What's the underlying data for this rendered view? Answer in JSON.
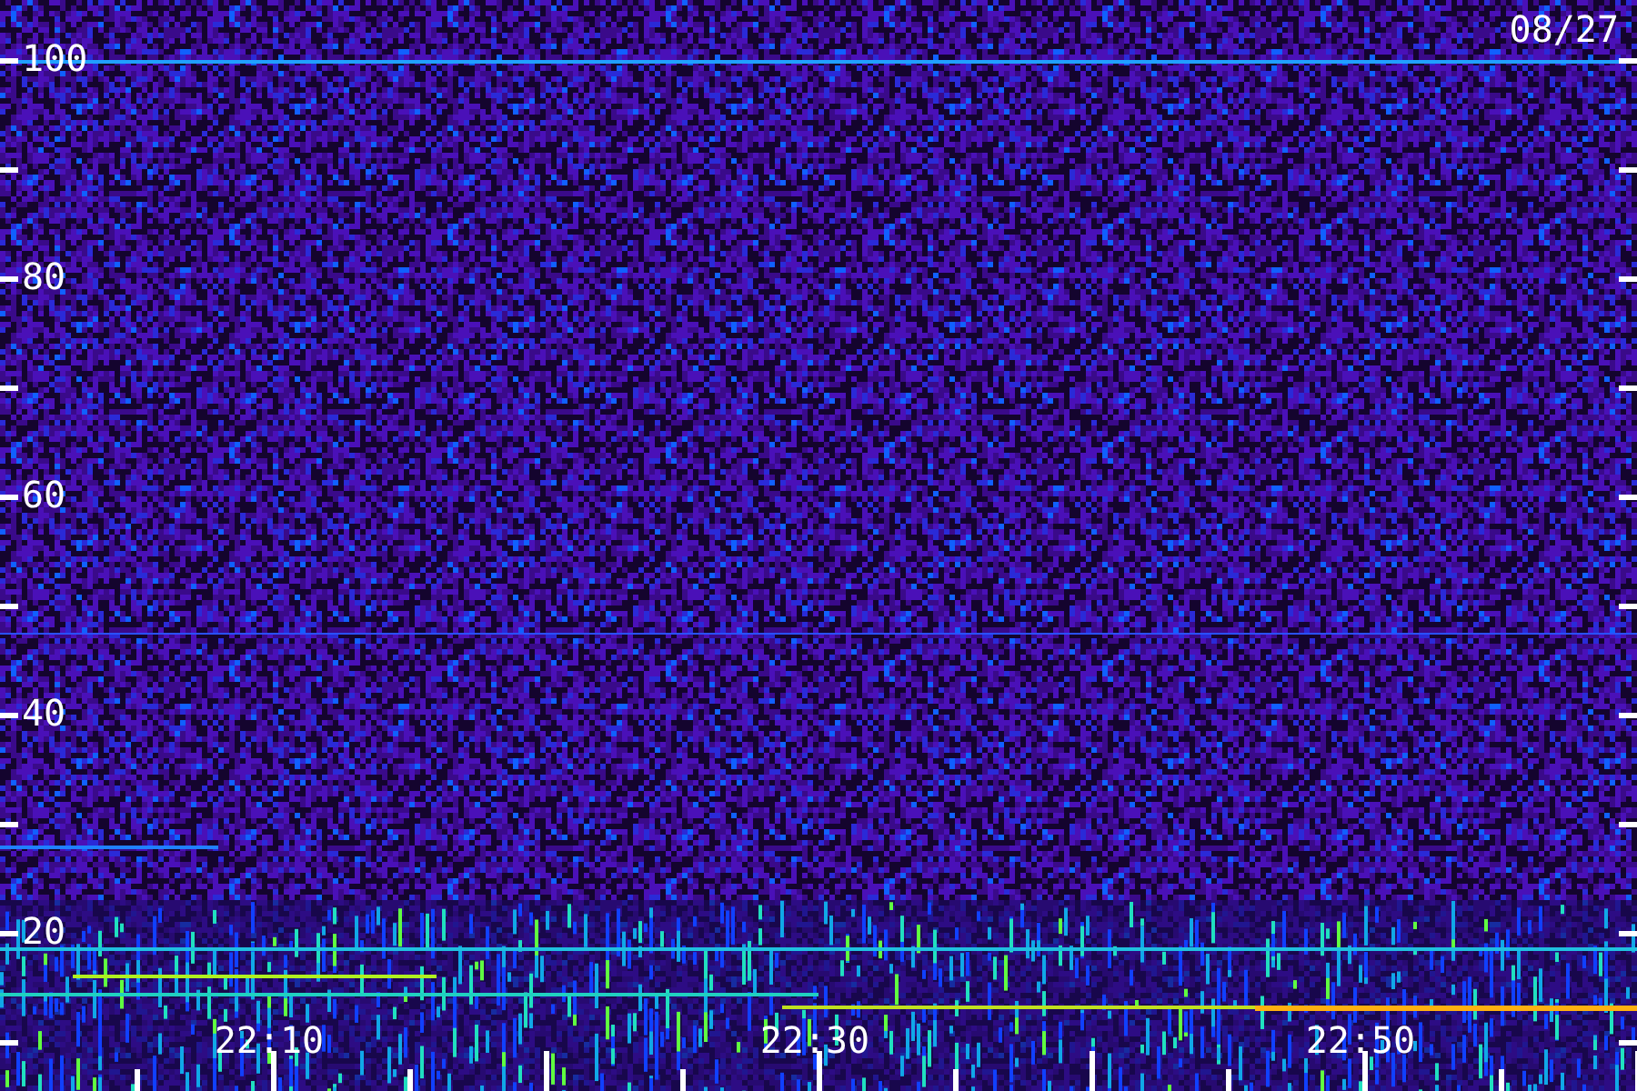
{
  "date": "08/27",
  "y_axis": {
    "labels": [
      "100",
      "80",
      "60",
      "40",
      "20"
    ]
  },
  "x_axis": {
    "labels": [
      "22:10",
      "22:30",
      "22:50"
    ]
  }
}
